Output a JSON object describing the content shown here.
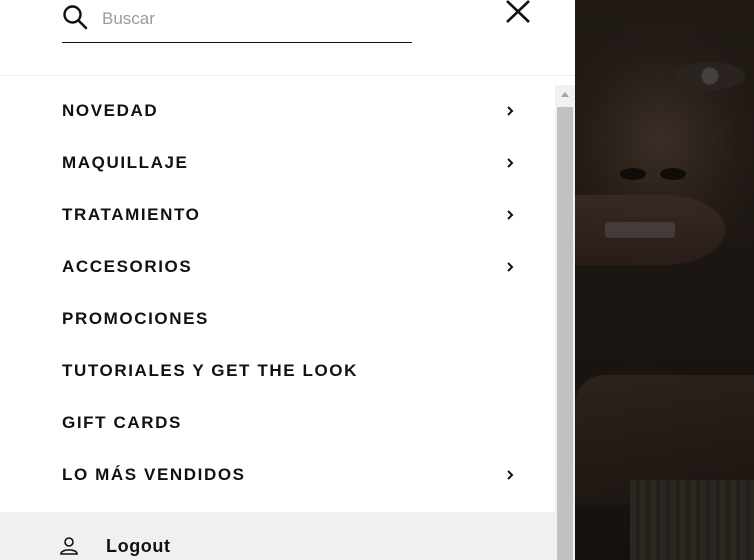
{
  "search": {
    "placeholder": "Buscar",
    "value": ""
  },
  "menu": {
    "items": [
      {
        "label": "NOVEDAD",
        "has_submenu": true
      },
      {
        "label": "MAQUILLAJE",
        "has_submenu": true
      },
      {
        "label": "TRATAMIENTO",
        "has_submenu": true
      },
      {
        "label": "ACCESORIOS",
        "has_submenu": true
      },
      {
        "label": "PROMOCIONES",
        "has_submenu": false
      },
      {
        "label": "TUTORIALES Y GET THE LOOK",
        "has_submenu": false
      },
      {
        "label": "GIFT CARDS",
        "has_submenu": false
      },
      {
        "label": "LO MÁS VENDIDOS",
        "has_submenu": true
      }
    ]
  },
  "account": {
    "logout_label": "Logout"
  },
  "icons": {
    "search": "search-icon",
    "close": "close-icon",
    "chevron": "chevron-right-icon",
    "user": "user-icon"
  },
  "colors": {
    "text": "#111111",
    "placeholder": "#9a9a9a",
    "footer_bg": "#f0f0f0",
    "overlay": "#1a1512"
  }
}
